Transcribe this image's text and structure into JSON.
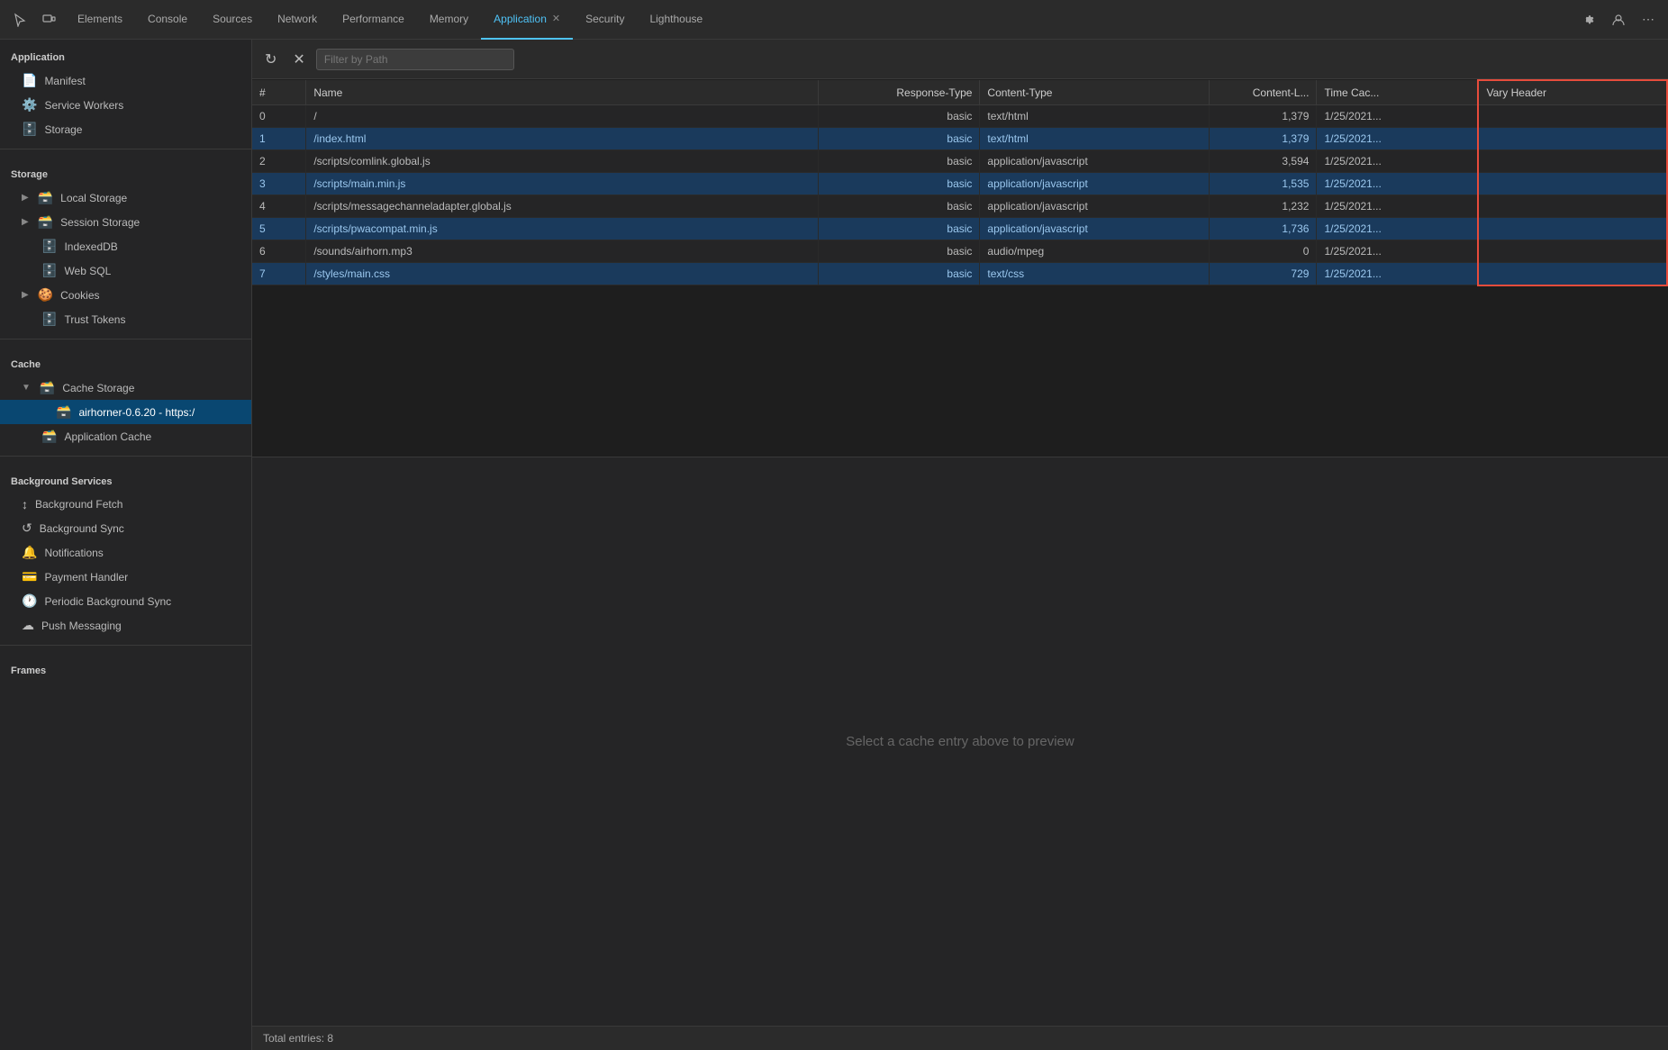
{
  "topbar": {
    "tabs": [
      {
        "id": "elements",
        "label": "Elements",
        "active": false
      },
      {
        "id": "console",
        "label": "Console",
        "active": false
      },
      {
        "id": "sources",
        "label": "Sources",
        "active": false
      },
      {
        "id": "network",
        "label": "Network",
        "active": false
      },
      {
        "id": "performance",
        "label": "Performance",
        "active": false
      },
      {
        "id": "memory",
        "label": "Memory",
        "active": false
      },
      {
        "id": "application",
        "label": "Application",
        "active": true,
        "closable": true
      },
      {
        "id": "security",
        "label": "Security",
        "active": false
      },
      {
        "id": "lighthouse",
        "label": "Lighthouse",
        "active": false
      }
    ]
  },
  "sidebar": {
    "app_section": "Application",
    "app_items": [
      {
        "id": "manifest",
        "label": "Manifest",
        "icon": "📄"
      },
      {
        "id": "service-workers",
        "label": "Service Workers",
        "icon": "⚙️"
      },
      {
        "id": "storage",
        "label": "Storage",
        "icon": "🗄️"
      }
    ],
    "storage_section": "Storage",
    "storage_items": [
      {
        "id": "local-storage",
        "label": "Local Storage",
        "icon": "🗃️",
        "expandable": true
      },
      {
        "id": "session-storage",
        "label": "Session Storage",
        "icon": "🗃️",
        "expandable": true
      },
      {
        "id": "indexeddb",
        "label": "IndexedDB",
        "icon": "🗄️"
      },
      {
        "id": "web-sql",
        "label": "Web SQL",
        "icon": "🗄️"
      },
      {
        "id": "cookies",
        "label": "Cookies",
        "icon": "🍪",
        "expandable": true
      },
      {
        "id": "trust-tokens",
        "label": "Trust Tokens",
        "icon": "🗄️"
      }
    ],
    "cache_section": "Cache",
    "cache_items": [
      {
        "id": "cache-storage",
        "label": "Cache Storage",
        "icon": "🗃️",
        "expanded": true
      },
      {
        "id": "airhorner",
        "label": "airhorner-0.6.20 - https:/",
        "icon": "🗃️",
        "indent": true,
        "selected": true
      },
      {
        "id": "app-cache",
        "label": "Application Cache",
        "icon": "🗃️"
      }
    ],
    "bg_services_section": "Background Services",
    "bg_items": [
      {
        "id": "bg-fetch",
        "label": "Background Fetch",
        "icon": "↕️"
      },
      {
        "id": "bg-sync",
        "label": "Background Sync",
        "icon": "🔄"
      },
      {
        "id": "notifications",
        "label": "Notifications",
        "icon": "🔔"
      },
      {
        "id": "payment-handler",
        "label": "Payment Handler",
        "icon": "💳"
      },
      {
        "id": "periodic-bg-sync",
        "label": "Periodic Background Sync",
        "icon": "🕐"
      },
      {
        "id": "push-messaging",
        "label": "Push Messaging",
        "icon": "☁️"
      }
    ],
    "frames_section": "Frames"
  },
  "filter": {
    "placeholder": "Filter by Path"
  },
  "table": {
    "columns": [
      "#",
      "Name",
      "Response-Type",
      "Content-Type",
      "Content-L...",
      "Time Cac...",
      "Vary Header"
    ],
    "rows": [
      {
        "num": "0",
        "name": "/",
        "response": "basic",
        "content_type": "text/html",
        "content_length": "1,379",
        "time_cached": "1/25/2021...",
        "vary": "",
        "highlight": false
      },
      {
        "num": "1",
        "name": "/index.html",
        "response": "basic",
        "content_type": "text/html",
        "content_length": "1,379",
        "time_cached": "1/25/2021...",
        "vary": "",
        "highlight": true
      },
      {
        "num": "2",
        "name": "/scripts/comlink.global.js",
        "response": "basic",
        "content_type": "application/javascript",
        "content_length": "3,594",
        "time_cached": "1/25/2021...",
        "vary": "",
        "highlight": false
      },
      {
        "num": "3",
        "name": "/scripts/main.min.js",
        "response": "basic",
        "content_type": "application/javascript",
        "content_length": "1,535",
        "time_cached": "1/25/2021...",
        "vary": "",
        "highlight": true
      },
      {
        "num": "4",
        "name": "/scripts/messagechanneladapter.global.js",
        "response": "basic",
        "content_type": "application/javascript",
        "content_length": "1,232",
        "time_cached": "1/25/2021...",
        "vary": "",
        "highlight": false
      },
      {
        "num": "5",
        "name": "/scripts/pwacompat.min.js",
        "response": "basic",
        "content_type": "application/javascript",
        "content_length": "1,736",
        "time_cached": "1/25/2021...",
        "vary": "",
        "highlight": true
      },
      {
        "num": "6",
        "name": "/sounds/airhorn.mp3",
        "response": "basic",
        "content_type": "audio/mpeg",
        "content_length": "0",
        "time_cached": "1/25/2021...",
        "vary": "",
        "highlight": false
      },
      {
        "num": "7",
        "name": "/styles/main.css",
        "response": "basic",
        "content_type": "text/css",
        "content_length": "729",
        "time_cached": "1/25/2021...",
        "vary": "",
        "highlight": true
      }
    ]
  },
  "preview": {
    "hint": "Select a cache entry above to preview"
  },
  "footer": {
    "text": "Total entries: 8"
  }
}
